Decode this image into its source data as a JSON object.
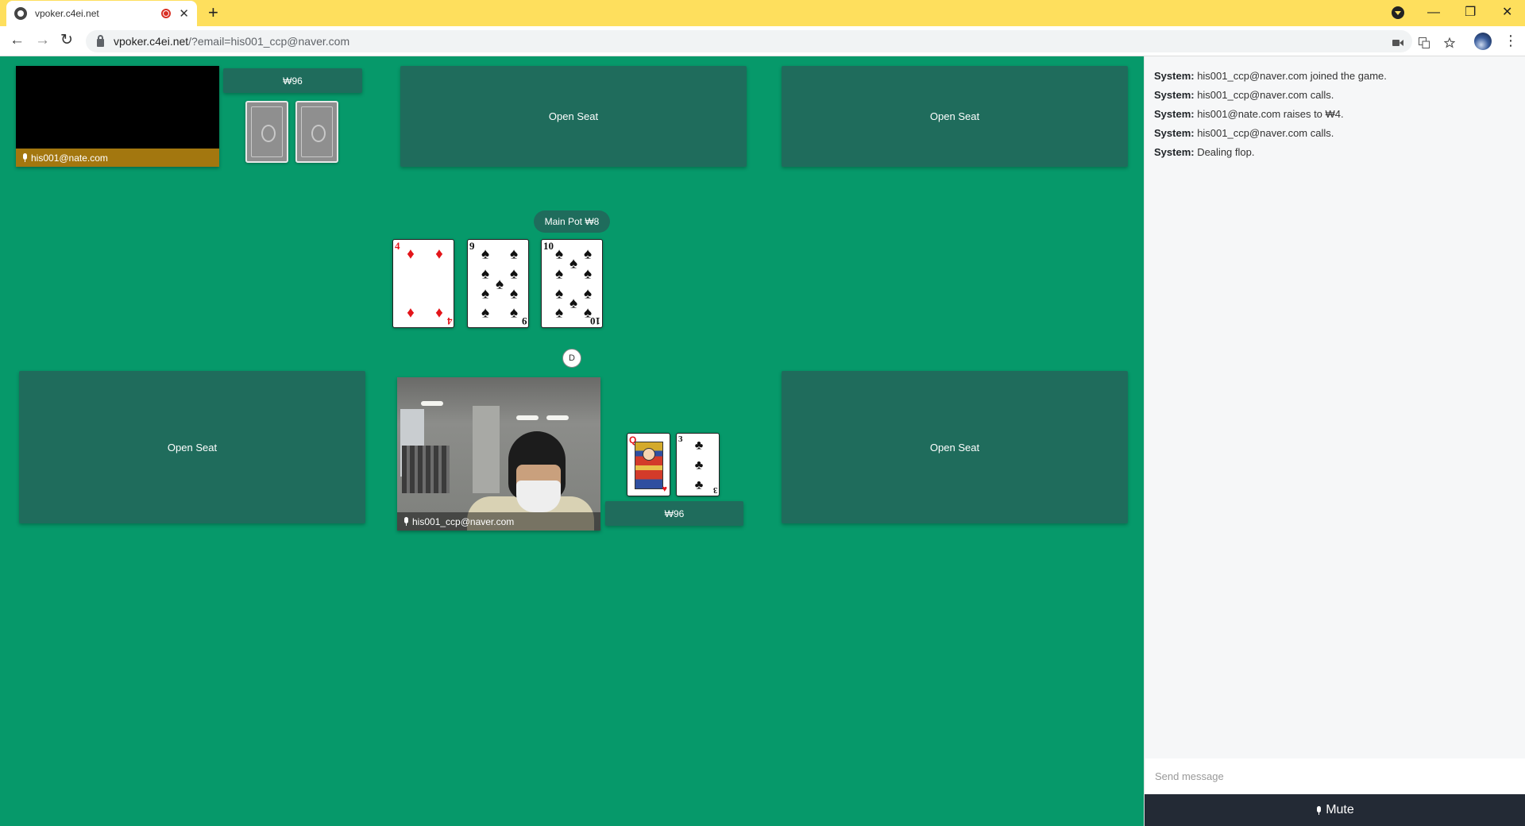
{
  "browser": {
    "tab_title": "vpoker.c4ei.net",
    "tab_close": "✕",
    "new_tab": "+",
    "url_host": "vpoker.c4ei.net",
    "url_rest": "/?email=his001_ccp@naver.com",
    "back": "←",
    "forward": "→",
    "reload": "↻",
    "minimize": "—",
    "restore": "❐",
    "close": "✕",
    "kebab": "⋮",
    "icons": [
      "camera-icon",
      "translate-icon",
      "star-icon"
    ]
  },
  "table": {
    "top_player": {
      "name": "his001@nate.com",
      "chips": "₩96",
      "name_bar_color": "#a3770f"
    },
    "open_seat_label": "Open Seat",
    "main_pot": "Main Pot ₩8",
    "dealer_button": "D",
    "board": [
      {
        "rank": "4",
        "suit": "♦",
        "color": "red"
      },
      {
        "rank": "9",
        "suit": "♠",
        "color": "black"
      },
      {
        "rank": "10",
        "suit": "♠",
        "color": "black"
      }
    ],
    "hero": {
      "name": "his001_ccp@naver.com",
      "chips": "₩96",
      "cards": [
        {
          "rank": "Q",
          "suit": "♥",
          "color": "red"
        },
        {
          "rank": "3",
          "suit": "♣",
          "color": "black"
        }
      ]
    }
  },
  "chat": {
    "messages": [
      {
        "sender": "System:",
        "text": " his001_ccp@naver.com joined the game."
      },
      {
        "sender": "System:",
        "text": " his001_ccp@naver.com calls."
      },
      {
        "sender": "System:",
        "text": " his001@nate.com raises to ₩4."
      },
      {
        "sender": "System:",
        "text": " his001_ccp@naver.com calls."
      },
      {
        "sender": "System:",
        "text": " Dealing flop."
      }
    ],
    "input_placeholder": "Send message",
    "mute_label": "Mute"
  },
  "colors": {
    "felt": "#06996a",
    "seat": "#1f6c5c",
    "tabbar": "#fedf5d",
    "mute_bg": "#232a35"
  }
}
